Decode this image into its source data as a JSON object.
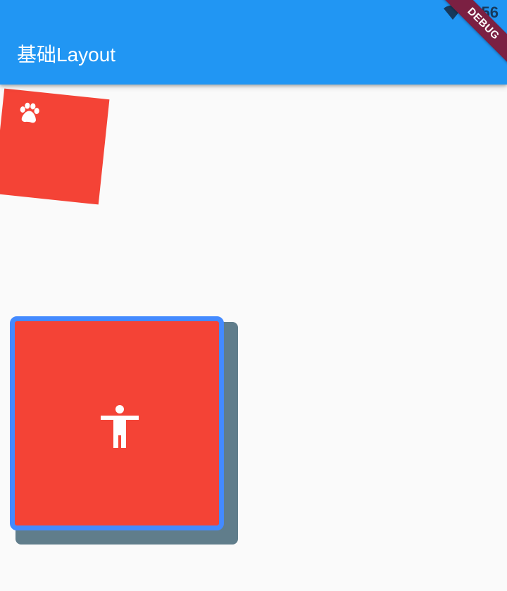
{
  "status_bar": {
    "time": "8:56",
    "wifi_icon": "wifi-icon"
  },
  "app_bar": {
    "title": "基础Layout",
    "background_color": "#2196f3"
  },
  "debug_banner": {
    "label": "DEBUG",
    "color": "#7b2042"
  },
  "rotated_box": {
    "color": "#f44336",
    "icon": "paw-icon"
  },
  "decorated_box": {
    "fill_color": "#f44336",
    "border_color": "#448aff",
    "shadow_color": "#607d8b",
    "icon": "accessibility-icon"
  }
}
